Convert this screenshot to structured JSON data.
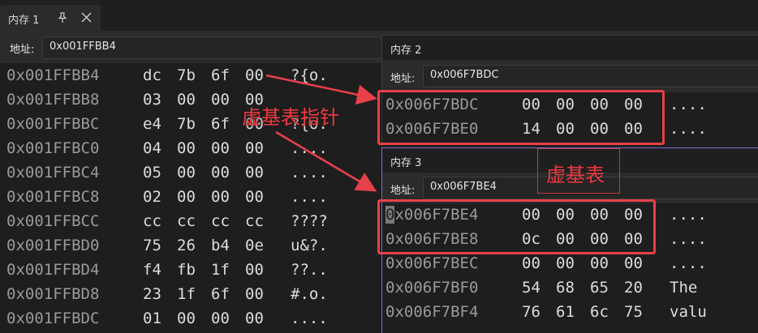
{
  "main": {
    "tab_label": "内存 1",
    "pin_icon": "📌",
    "close_icon": "✕",
    "address_label": "地址:",
    "address_value": "0x001FFBB4",
    "rows": [
      {
        "addr": "0x001FFBB4",
        "bytes": [
          "dc",
          "7b",
          "6f",
          "00"
        ],
        "text": "?{o."
      },
      {
        "addr": "0x001FFBB8",
        "bytes": [
          "03",
          "00",
          "00",
          "00"
        ],
        "text": ""
      },
      {
        "addr": "0x001FFBBC",
        "bytes": [
          "e4",
          "7b",
          "6f",
          "00"
        ],
        "text": "?{o."
      },
      {
        "addr": "0x001FFBC0",
        "bytes": [
          "04",
          "00",
          "00",
          "00"
        ],
        "text": "...."
      },
      {
        "addr": "0x001FFBC4",
        "bytes": [
          "05",
          "00",
          "00",
          "00"
        ],
        "text": "...."
      },
      {
        "addr": "0x001FFBC8",
        "bytes": [
          "02",
          "00",
          "00",
          "00"
        ],
        "text": "...."
      },
      {
        "addr": "0x001FFBCC",
        "bytes": [
          "cc",
          "cc",
          "cc",
          "cc"
        ],
        "text": "????"
      },
      {
        "addr": "0x001FFBD0",
        "bytes": [
          "75",
          "26",
          "b4",
          "0e"
        ],
        "text": "u&?."
      },
      {
        "addr": "0x001FFBD4",
        "bytes": [
          "f4",
          "fb",
          "1f",
          "00"
        ],
        "text": "??.."
      },
      {
        "addr": "0x001FFBD8",
        "bytes": [
          "23",
          "1f",
          "6f",
          "00"
        ],
        "text": "#.o."
      },
      {
        "addr": "0x001FFBDC",
        "bytes": [
          "01",
          "00",
          "00",
          "00"
        ],
        "text": "...."
      }
    ]
  },
  "mem2": {
    "title": "内存 2",
    "address_label": "地址:",
    "address_value": "0x006F7BDC",
    "rows": [
      {
        "addr": "0x006F7BDC",
        "bytes": [
          "00",
          "00",
          "00",
          "00"
        ],
        "text": "...."
      },
      {
        "addr": "0x006F7BE0",
        "bytes": [
          "14",
          "00",
          "00",
          "00"
        ],
        "text": "...."
      }
    ]
  },
  "mem3": {
    "title": "内存 3",
    "address_label": "地址:",
    "address_value": "0x006F7BE4",
    "rows": [
      {
        "addr": "0x006F7BE4",
        "bytes": [
          "00",
          "00",
          "00",
          "00"
        ],
        "text": "...."
      },
      {
        "addr": "0x006F7BE8",
        "bytes": [
          "0c",
          "00",
          "00",
          "00"
        ],
        "text": "...."
      },
      {
        "addr": "0x006F7BEC",
        "bytes": [
          "00",
          "00",
          "00",
          "00"
        ],
        "text": "...."
      },
      {
        "addr": "0x006F7BF0",
        "bytes": [
          "54",
          "68",
          "65",
          "20"
        ],
        "text": "The "
      },
      {
        "addr": "0x006F7BF4",
        "bytes": [
          "76",
          "61",
          "6c",
          "75"
        ],
        "text": "valu"
      }
    ]
  },
  "annotations": {
    "vptr_label": "虚基表指针",
    "vtable_label": "虚基表",
    "accent_color": "#e8404a"
  }
}
